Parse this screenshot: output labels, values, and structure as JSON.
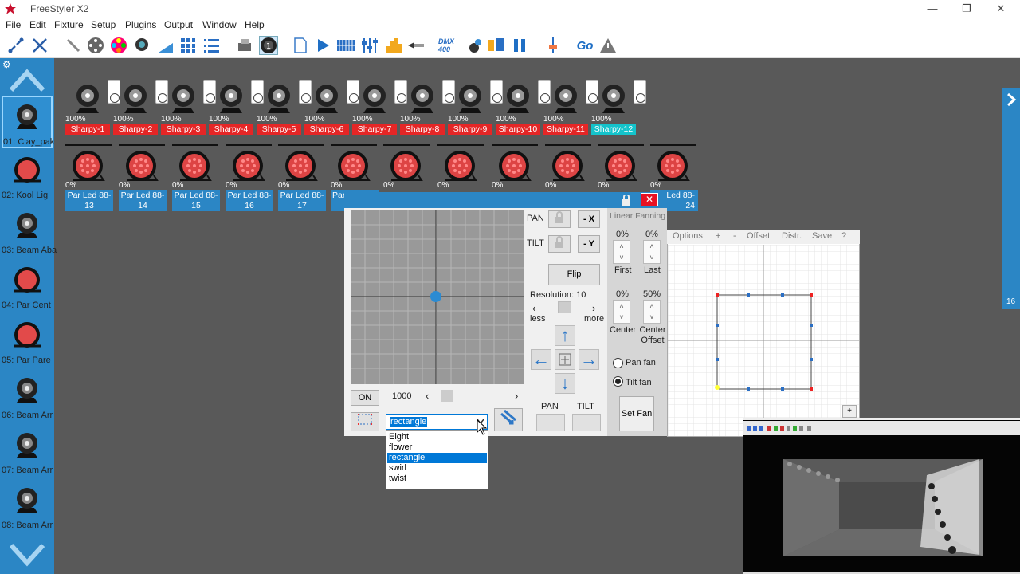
{
  "app": {
    "title": "FreeStyler X2"
  },
  "window": {
    "minimize": "—",
    "restore": "❐",
    "close": "✕"
  },
  "menu": [
    "File",
    "Edit",
    "Fixture",
    "Setup",
    "Plugins",
    "Output",
    "Window",
    "Help"
  ],
  "toolbar": {
    "go": "Go",
    "dmx": "DMX 400"
  },
  "sidebar": {
    "items": [
      {
        "label": "01: Clay_pak",
        "type": "head"
      },
      {
        "label": "02: Kool Lig",
        "type": "par"
      },
      {
        "label": "03: Beam Aba",
        "type": "head"
      },
      {
        "label": "04: Par Cent",
        "type": "par"
      },
      {
        "label": "05: Par Pare",
        "type": "par"
      },
      {
        "label": "06: Beam Arr",
        "type": "head"
      },
      {
        "label": "07: Beam Arr",
        "type": "head"
      },
      {
        "label": "08: Beam Arr",
        "type": "head"
      }
    ]
  },
  "right_tab": {
    "count": "16"
  },
  "fixtures_row1": [
    {
      "pct": "100%",
      "name": "Sharpy-1"
    },
    {
      "pct": "100%",
      "name": "Sharpy-2"
    },
    {
      "pct": "100%",
      "name": "Sharpy-3"
    },
    {
      "pct": "100%",
      "name": "Sharpy-4"
    },
    {
      "pct": "100%",
      "name": "Sharpy-5"
    },
    {
      "pct": "100%",
      "name": "Sharpy-6"
    },
    {
      "pct": "100%",
      "name": "Sharpy-7"
    },
    {
      "pct": "100%",
      "name": "Sharpy-8"
    },
    {
      "pct": "100%",
      "name": "Sharpy-9"
    },
    {
      "pct": "100%",
      "name": "Sharpy-10"
    },
    {
      "pct": "100%",
      "name": "Sharpy-11"
    },
    {
      "pct": "100%",
      "name": "Sharpy-12",
      "selected": true
    }
  ],
  "fixtures_row2": [
    {
      "pct": "0%",
      "name": "Par Led 88-13"
    },
    {
      "pct": "0%",
      "name": "Par Led 88-14"
    },
    {
      "pct": "0%",
      "name": "Par Led 88-15"
    },
    {
      "pct": "0%",
      "name": "Par Led 88-16"
    },
    {
      "pct": "0%",
      "name": "Par Led 88-17"
    },
    {
      "pct": "0%",
      "name": "Par"
    },
    {
      "pct": "0%",
      "name": ""
    },
    {
      "pct": "0%",
      "name": ""
    },
    {
      "pct": "0%",
      "name": ""
    },
    {
      "pct": "0%",
      "name": ""
    },
    {
      "pct": "0%",
      "name": ""
    },
    {
      "pct": "0%",
      "name": "Par Led 88-24"
    }
  ],
  "dialog": {
    "pan": "PAN",
    "tilt": "TILT",
    "minus_x": "- X",
    "minus_y": "- Y",
    "flip": "Flip",
    "resolution": "Resolution: 10",
    "less": "less",
    "more": "more",
    "on": "ON",
    "speed": "1000",
    "pan_label": "PAN",
    "tilt_label": "TILT",
    "shape": "rectangle",
    "shapes": [
      "Eight",
      "flower",
      "rectangle",
      "swirl",
      "twist"
    ],
    "selected_shape": "rectangle"
  },
  "fanning": {
    "title": "Linear Fanning",
    "first_pct": "0%",
    "last_pct": "0%",
    "first": "First",
    "last": "Last",
    "center_pct": "0%",
    "center_offset_pct": "50%",
    "center": "Center",
    "center_offset": "Center Offset",
    "pan_fan": "Pan fan",
    "tilt_fan": "Tilt fan",
    "tilt_selected": true,
    "set_fan": "Set Fan"
  },
  "fan_menu": [
    "Options",
    "+",
    "-",
    "Offset",
    "Distr.",
    "Save",
    "?"
  ],
  "fan_plus": "+"
}
